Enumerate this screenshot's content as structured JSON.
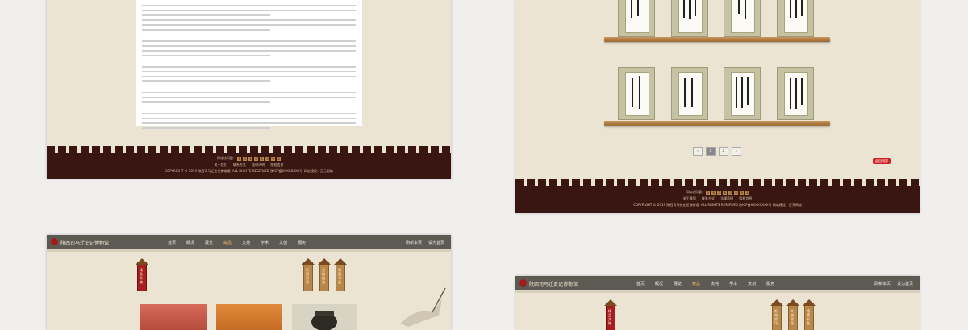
{
  "site": {
    "brand": "陕西司马迁史记博物馆",
    "nav_items": [
      "首页",
      "概况",
      "展览",
      "藏品",
      "文苑",
      "学术",
      "文创",
      "服务"
    ],
    "active_nav": "藏品",
    "nav_right": [
      "刷新本页",
      "设为首页"
    ]
  },
  "footer": {
    "visitors_label": "网站访问量：",
    "visitors_digits": [
      "5",
      "8",
      "5",
      "8",
      "5",
      "4",
      "9",
      "2"
    ],
    "links": [
      "关于我们",
      "联系方式",
      "法律声明",
      "版权信息"
    ],
    "copyright": "COPYRIGHT © 2019 陕西司马迁史记博物馆. ALL RIGHTS RESERVED 陕ICP备XXXXXXXX号",
    "credit": "网站建设：正元网络"
  },
  "pager": [
    "«",
    "1",
    "2",
    "»"
  ],
  "stamp_label": "返回顶部",
  "banners_p3": [
    "精品文物",
    "新闻资讯",
    "文物展览",
    "馆藏书画"
  ],
  "banners_p4": [
    "精品文物",
    "新闻资讯",
    "文物展览",
    "馆藏书画"
  ]
}
